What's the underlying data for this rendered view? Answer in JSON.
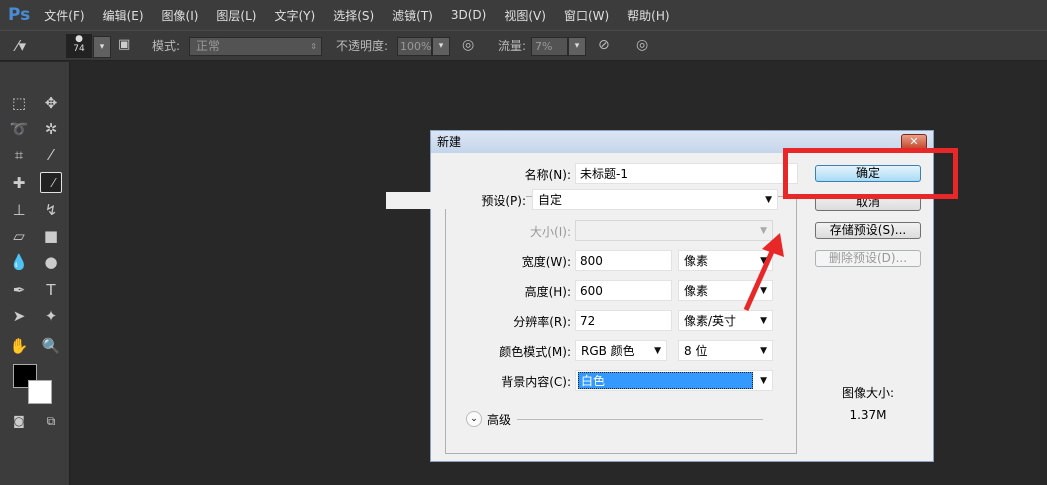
{
  "app": {
    "logo": "Ps"
  },
  "menu": [
    "文件(F)",
    "编辑(E)",
    "图像(I)",
    "图层(L)",
    "文字(Y)",
    "选择(S)",
    "滤镜(T)",
    "3D(D)",
    "视图(V)",
    "窗口(W)",
    "帮助(H)"
  ],
  "options": {
    "brush_size": "74",
    "mode_label": "模式:",
    "mode_value": "正常",
    "opacity_label": "不透明度:",
    "opacity_value": "100%",
    "flow_label": "流量:",
    "flow_value": "7%"
  },
  "dialog": {
    "title": "新建",
    "close": "✕",
    "name_label": "名称(N):",
    "name_value": "未标题-1",
    "preset_label": "预设(P):",
    "preset_value": "自定",
    "size_label": "大小(I):",
    "size_value": "",
    "width_label": "宽度(W):",
    "width_value": "800",
    "width_unit": "像素",
    "height_label": "高度(H):",
    "height_value": "600",
    "height_unit": "像素",
    "res_label": "分辨率(R):",
    "res_value": "72",
    "res_unit": "像素/英寸",
    "mode_label": "颜色模式(M):",
    "mode_value": "RGB 颜色",
    "depth_value": "8 位",
    "bg_label": "背景内容(C):",
    "bg_value": "白色",
    "advanced": "高级",
    "ok": "确定",
    "cancel": "取消",
    "save_preset": "存储预设(S)...",
    "delete_preset": "删除预设(D)...",
    "image_size_label": "图像大小:",
    "image_size_value": "1.37M"
  },
  "colors": {
    "highlight": "#e82828",
    "selection": "#3399ff"
  }
}
